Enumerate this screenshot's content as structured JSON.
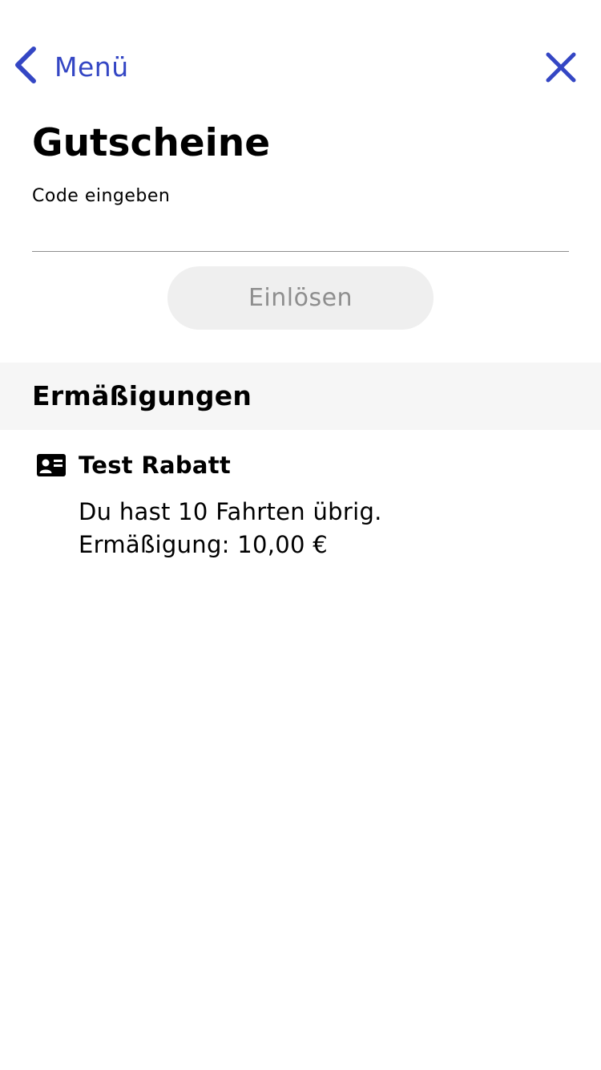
{
  "colors": {
    "accent": "#3446c4",
    "text": "#000000",
    "muted": "#8e8e8e",
    "button_bg": "#efefef",
    "section_bg": "#f6f6f6",
    "divider": "#8e8e8e"
  },
  "nav": {
    "back_icon": "chevron-left-icon",
    "back_label": "Menü",
    "close_icon": "close-icon"
  },
  "page": {
    "title": "Gutscheine"
  },
  "code_form": {
    "label": "Code eingeben",
    "value": "",
    "placeholder": "",
    "redeem_label": "Einlösen"
  },
  "discounts": {
    "section_title": "Ermäßigungen",
    "items": [
      {
        "icon": "id-card-icon",
        "name": "Test Rabatt",
        "rides_text": "Du hast 10 Fahrten übrig.",
        "amount_text": "Ermäßigung: 10,00 €"
      }
    ]
  }
}
